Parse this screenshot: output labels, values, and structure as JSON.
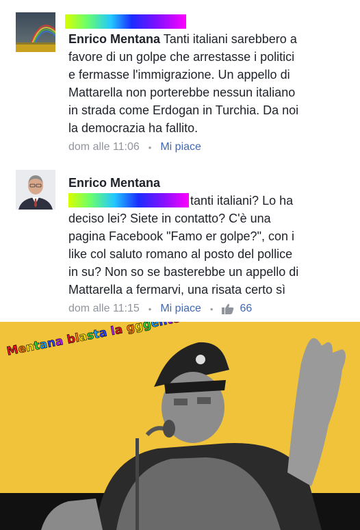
{
  "comments": [
    {
      "author": "Enrico Mentana",
      "text_lines": [
        " Tanti italiani sarebbero a",
        "favore di un golpe che arrestasse i politici",
        "e fermasse l'immigrazione. Un appello di",
        "Mattarella non porterebbe nessun italiano",
        "in strada come Erdogan in Turchia. Da noi",
        "la democrazia ha fallito."
      ],
      "time": "dom alle 11:06",
      "separator": "•",
      "like_label": "Mi piace"
    },
    {
      "author": "Enrico Mentana",
      "text_lines": [
        "tanti italiani? Lo ha",
        "deciso lei? Siete in contatto? C'è una",
        "pagina Facebook \"Famo er golpe?\", con i",
        "like col saluto romano al posto del pollice",
        "in su? Non so se basterebbe un appello di",
        "Mattarella a fermarvi, una risata certo sì"
      ],
      "time": "dom alle 11:15",
      "separator": "•",
      "like_label": "Mi piace",
      "separator2": "•",
      "reaction_icon": "thumbs-up-icon",
      "reaction_count": "66"
    }
  ],
  "meme": {
    "caption": "Mentana blasta la gggente!!!",
    "background_color": "#f0c33a"
  },
  "colors": {
    "text": "#1d2129",
    "meta": "#90949c",
    "link": "#4267b2"
  }
}
